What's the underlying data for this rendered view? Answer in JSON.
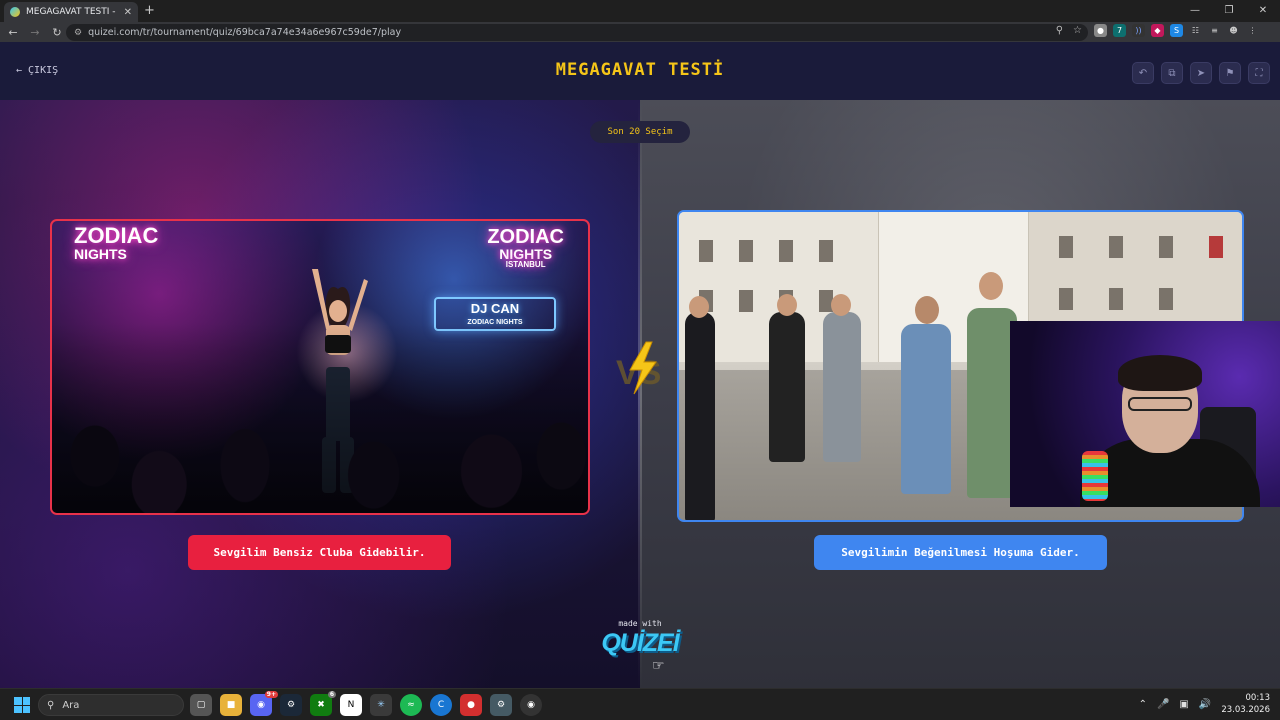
{
  "browser": {
    "tab_title": "MEGAGAVAT TESTİ - Tier",
    "url": "quizei.com/tr/tournament/quiz/69bca7a74e34a6e967c59de7/play",
    "new_tab_symbol": "+",
    "tab_close_symbol": "✕",
    "icons": [
      "back-icon",
      "forward-icon",
      "reload-icon",
      "site-info-icon",
      "zoom-icon",
      "bookmark-star-icon",
      "extensions-icon",
      "tab-search-icon",
      "profile-icon",
      "menu-kebab-icon"
    ],
    "window_controls": [
      "minimize",
      "restore",
      "close"
    ]
  },
  "header": {
    "exit_label": "ÇIKIŞ",
    "title": "MEGAGAVAT TESTİ",
    "tools": [
      "undo-icon",
      "share-icon",
      "send-icon",
      "flag-icon",
      "fullscreen-icon"
    ]
  },
  "quiz": {
    "round_label": "Son 20 Seçim",
    "option_left": {
      "label": "Sevgilim Bensiz Cluba Gidebilir.",
      "image_text": {
        "sign_left_1": "ZODIAC",
        "sign_left_2": "NIGHTS",
        "sign_right_1": "ZODIAC",
        "sign_right_2": "NIGHTS",
        "sign_right_3": "ISTANBUL",
        "dj_1": "DJ CAN",
        "dj_2": "ZODIAC NIGHTS"
      }
    },
    "option_right": {
      "label": "Sevgilimin Beğenilmesi Hoşuma Gider."
    },
    "vs_icon": "vs-lightning-icon",
    "accent_left": "#e8203f",
    "accent_right": "#3f86f0",
    "title_color": "#f5c518"
  },
  "branding": {
    "made_with": "made with",
    "brand": "QUİZEİ"
  },
  "taskbar": {
    "search_placeholder": "Ara",
    "apps": [
      "file-explorer-icon",
      "folder-icon",
      "discord-icon",
      "steam-icon",
      "xbox-icon",
      "notion-icon",
      "perplexity-icon",
      "spotify-icon",
      "ccleaner-icon",
      "recorder-icon",
      "settings-icon",
      "chrome-icon"
    ],
    "discord_badge": "9+",
    "xbox_badge": "6",
    "time": "00:13",
    "date": "23.03.2026"
  }
}
